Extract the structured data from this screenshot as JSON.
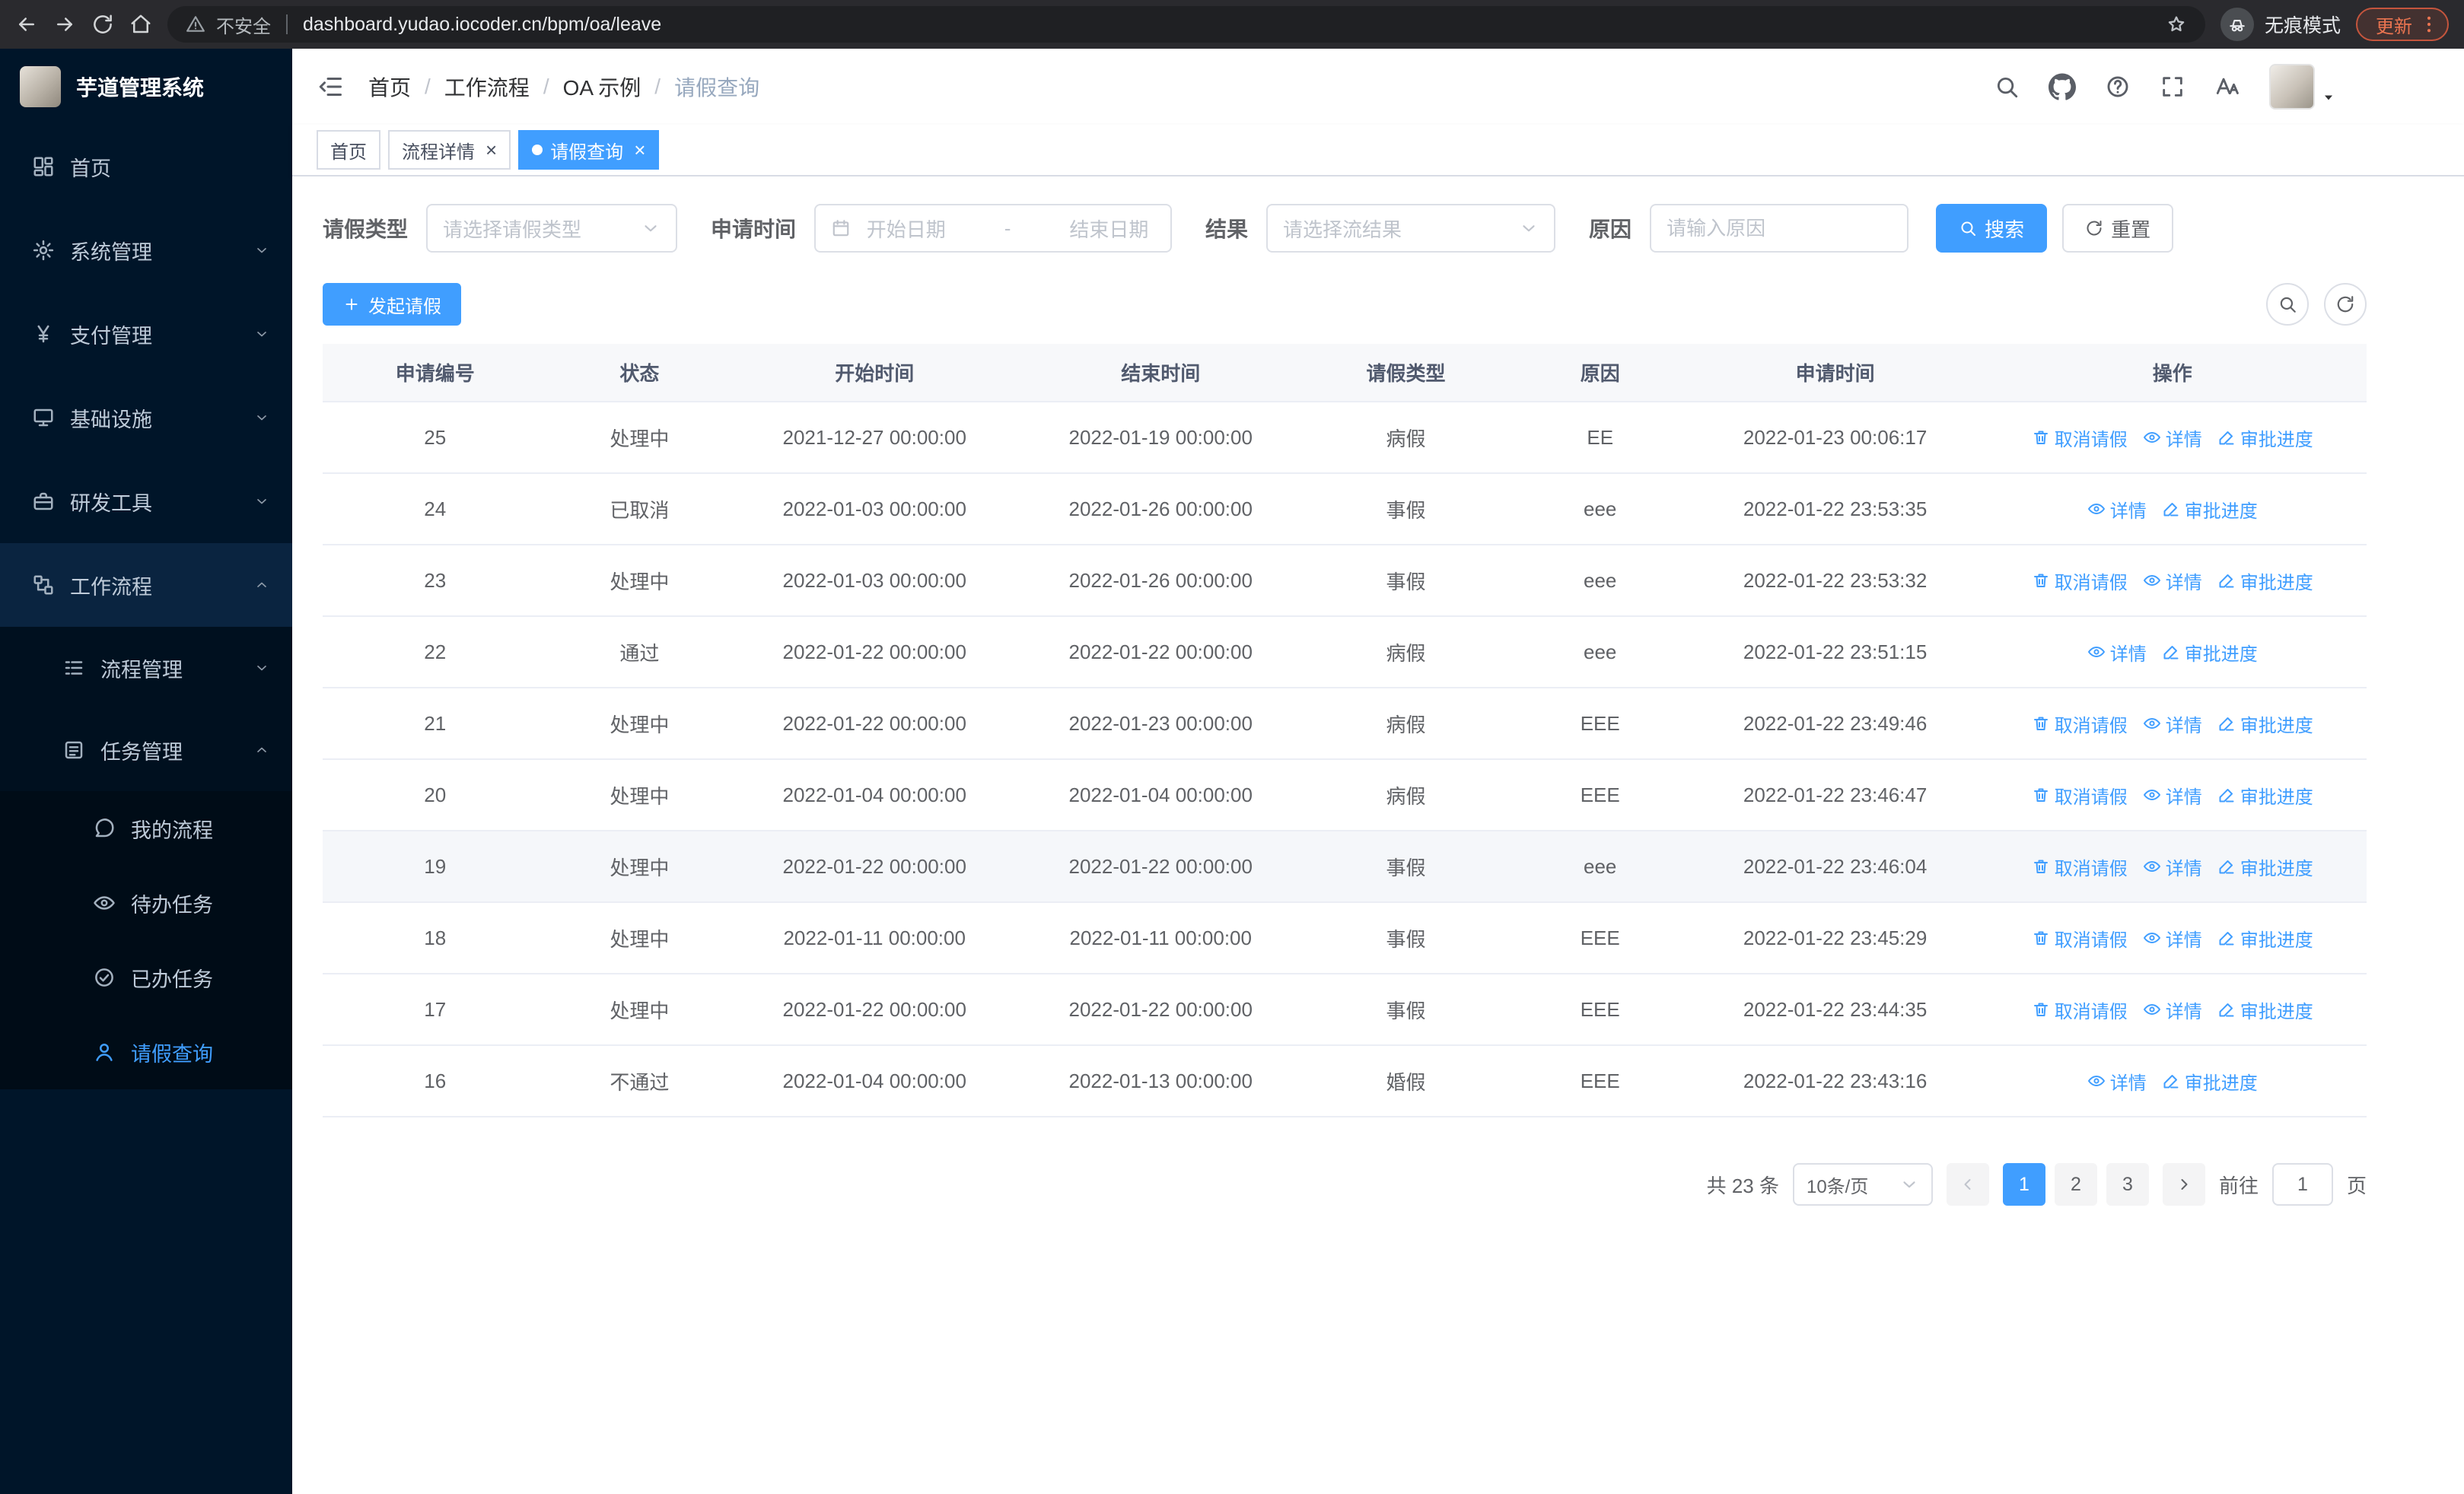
{
  "theme": {
    "primary": "#409eff",
    "sidebar_bg": "#001529",
    "sidebar_text": "#bfcbd9",
    "link_blue": "#409eff",
    "update_chip": "#ea7450"
  },
  "browser": {
    "security_warning": "不安全",
    "url": "dashboard.yudao.iocoder.cn/bpm/oa/leave",
    "incognito_label": "无痕模式",
    "update_label": "更新"
  },
  "sidebar": {
    "logo_title": "芋道管理系统",
    "menu": [
      {
        "key": "home",
        "label": "首页",
        "icon": "dashboard-icon",
        "level": 1
      },
      {
        "key": "system",
        "label": "系统管理",
        "icon": "gear-icon",
        "level": 1,
        "arrow": "down"
      },
      {
        "key": "payment",
        "label": "支付管理",
        "icon": "yen-icon",
        "level": 1,
        "arrow": "down"
      },
      {
        "key": "infrastructure",
        "label": "基础设施",
        "icon": "infra-icon",
        "level": 1,
        "arrow": "down"
      },
      {
        "key": "dev-tools",
        "label": "研发工具",
        "icon": "tools-icon",
        "level": 1,
        "arrow": "down"
      },
      {
        "key": "workflow",
        "label": "工作流程",
        "icon": "workflow-icon",
        "level": 1,
        "arrow": "up",
        "expanded": true
      },
      {
        "key": "process-mgmt",
        "label": "流程管理",
        "icon": "process-icon",
        "level": 2,
        "arrow": "down"
      },
      {
        "key": "task-mgmt",
        "label": "任务管理",
        "icon": "task-icon",
        "level": 2,
        "arrow": "up",
        "expanded": true
      },
      {
        "key": "my-process",
        "label": "我的流程",
        "icon": "chat-icon",
        "level": 3
      },
      {
        "key": "todo-tasks",
        "label": "待办任务",
        "icon": "eye-icon",
        "level": 3
      },
      {
        "key": "done-tasks",
        "label": "已办任务",
        "icon": "check-icon",
        "level": 3
      },
      {
        "key": "leave-query",
        "label": "请假查询",
        "icon": "user-icon",
        "level": 3,
        "active": true
      }
    ]
  },
  "header": {
    "breadcrumb": [
      "首页",
      "工作流程",
      "OA 示例",
      "请假查询"
    ]
  },
  "tabs": [
    {
      "key": "home",
      "label": "首页",
      "closable": false,
      "active": false
    },
    {
      "key": "process-detail",
      "label": "流程详情",
      "closable": true,
      "active": false
    },
    {
      "key": "leave-query",
      "label": "请假查询",
      "closable": true,
      "active": true
    }
  ],
  "filters": {
    "leave_type_label": "请假类型",
    "leave_type_placeholder": "请选择请假类型",
    "apply_time_label": "申请时间",
    "start_date_placeholder": "开始日期",
    "range_separator": "-",
    "end_date_placeholder": "结束日期",
    "result_label": "结果",
    "result_placeholder": "请选择流结果",
    "reason_label": "原因",
    "reason_placeholder": "请输入原因",
    "search_label": "搜索",
    "reset_label": "重置"
  },
  "toolbar": {
    "create_label": "发起请假"
  },
  "table": {
    "columns": [
      "申请编号",
      "状态",
      "开始时间",
      "结束时间",
      "请假类型",
      "原因",
      "申请时间",
      "操作"
    ],
    "actions": {
      "cancel": {
        "label": "取消请假",
        "icon": "trash-icon"
      },
      "detail": {
        "label": "详情",
        "icon": "eye-icon"
      },
      "progress": {
        "label": "审批进度",
        "icon": "edit-icon"
      }
    },
    "rows": [
      {
        "no": "25",
        "status": "处理中",
        "start": "2021-12-27 00:00:00",
        "end": "2022-01-19 00:00:00",
        "type": "病假",
        "reason": "EE",
        "applied": "2022-01-23 00:06:17",
        "actions": [
          "cancel",
          "detail",
          "progress"
        ]
      },
      {
        "no": "24",
        "status": "已取消",
        "start": "2022-01-03 00:00:00",
        "end": "2022-01-26 00:00:00",
        "type": "事假",
        "reason": "eee",
        "applied": "2022-01-22 23:53:35",
        "actions": [
          "detail",
          "progress"
        ]
      },
      {
        "no": "23",
        "status": "处理中",
        "start": "2022-01-03 00:00:00",
        "end": "2022-01-26 00:00:00",
        "type": "事假",
        "reason": "eee",
        "applied": "2022-01-22 23:53:32",
        "actions": [
          "cancel",
          "detail",
          "progress"
        ]
      },
      {
        "no": "22",
        "status": "通过",
        "start": "2022-01-22 00:00:00",
        "end": "2022-01-22 00:00:00",
        "type": "病假",
        "reason": "eee",
        "applied": "2022-01-22 23:51:15",
        "actions": [
          "detail",
          "progress"
        ]
      },
      {
        "no": "21",
        "status": "处理中",
        "start": "2022-01-22 00:00:00",
        "end": "2022-01-23 00:00:00",
        "type": "病假",
        "reason": "EEE",
        "applied": "2022-01-22 23:49:46",
        "actions": [
          "cancel",
          "detail",
          "progress"
        ]
      },
      {
        "no": "20",
        "status": "处理中",
        "start": "2022-01-04 00:00:00",
        "end": "2022-01-04 00:00:00",
        "type": "病假",
        "reason": "EEE",
        "applied": "2022-01-22 23:46:47",
        "actions": [
          "cancel",
          "detail",
          "progress"
        ]
      },
      {
        "no": "19",
        "status": "处理中",
        "start": "2022-01-22 00:00:00",
        "end": "2022-01-22 00:00:00",
        "type": "事假",
        "reason": "eee",
        "applied": "2022-01-22 23:46:04",
        "actions": [
          "cancel",
          "detail",
          "progress"
        ],
        "highlighted": true
      },
      {
        "no": "18",
        "status": "处理中",
        "start": "2022-01-11 00:00:00",
        "end": "2022-01-11 00:00:00",
        "type": "事假",
        "reason": "EEE",
        "applied": "2022-01-22 23:45:29",
        "actions": [
          "cancel",
          "detail",
          "progress"
        ]
      },
      {
        "no": "17",
        "status": "处理中",
        "start": "2022-01-22 00:00:00",
        "end": "2022-01-22 00:00:00",
        "type": "事假",
        "reason": "EEE",
        "applied": "2022-01-22 23:44:35",
        "actions": [
          "cancel",
          "detail",
          "progress"
        ]
      },
      {
        "no": "16",
        "status": "不通过",
        "start": "2022-01-04 00:00:00",
        "end": "2022-01-13 00:00:00",
        "type": "婚假",
        "reason": "EEE",
        "applied": "2022-01-22 23:43:16",
        "actions": [
          "detail",
          "progress"
        ]
      }
    ]
  },
  "pagination": {
    "total_label": "共 23 条",
    "page_size_label": "10条/页",
    "pages": [
      "1",
      "2",
      "3"
    ],
    "active_page": "1",
    "goto_label": "前往",
    "goto_value": "1",
    "goto_suffix": "页"
  }
}
